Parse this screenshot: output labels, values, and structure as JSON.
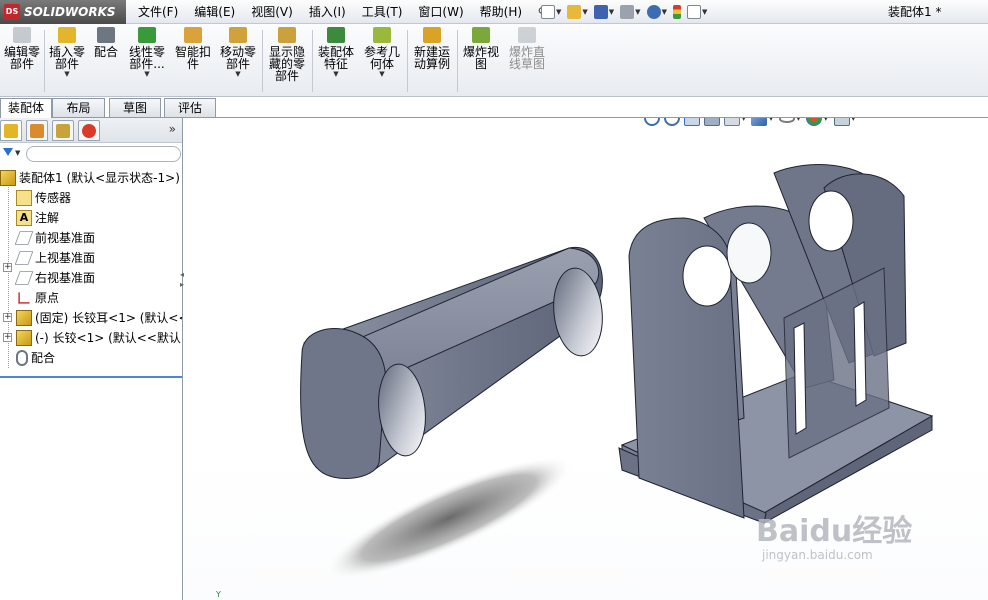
{
  "app": {
    "brand": "SOLIDWORKS",
    "brand_mark": "DS",
    "document_title": "装配体1 *"
  },
  "menu": [
    {
      "label": "文件(F)"
    },
    {
      "label": "编辑(E)"
    },
    {
      "label": "视图(V)"
    },
    {
      "label": "插入(I)"
    },
    {
      "label": "工具(T)"
    },
    {
      "label": "窗口(W)"
    },
    {
      "label": "帮助(H)"
    }
  ],
  "commands": [
    {
      "label": "编辑零\n部件",
      "icon": "edit-component-icon",
      "color": "#9aa3ad",
      "enabled": false,
      "dropdown": false
    },
    {
      "label": "插入零\n部件",
      "icon": "insert-component-icon",
      "color": "#e3b52a",
      "enabled": true,
      "dropdown": true
    },
    {
      "label": "配合",
      "icon": "mate-icon",
      "color": "#6d7681",
      "enabled": true,
      "dropdown": false
    },
    {
      "label": "线性零\n部件...",
      "icon": "linear-pattern-icon",
      "color": "#3a9a3a",
      "enabled": true,
      "dropdown": true
    },
    {
      "label": "智能扣\n件",
      "icon": "smart-fasteners-icon",
      "color": "#d9a23a",
      "enabled": true,
      "dropdown": false
    },
    {
      "label": "移动零\n部件",
      "icon": "move-component-icon",
      "color": "#cfa33a",
      "enabled": true,
      "dropdown": true
    },
    {
      "label": "显示隐\n藏的零\n部件",
      "icon": "show-hidden-icon",
      "color": "#caa13a",
      "enabled": true,
      "dropdown": false
    },
    {
      "label": "装配体\n特征",
      "icon": "assembly-features-icon",
      "color": "#3c8a3c",
      "enabled": true,
      "dropdown": true
    },
    {
      "label": "参考几\n何体",
      "icon": "reference-geometry-icon",
      "color": "#9ab83a",
      "enabled": true,
      "dropdown": true
    },
    {
      "label": "新建运\n动算例",
      "icon": "new-motion-study-icon",
      "color": "#d9a326",
      "enabled": true,
      "dropdown": false
    },
    {
      "label": "爆炸视\n图",
      "icon": "exploded-view-icon",
      "color": "#7aa83a",
      "enabled": true,
      "dropdown": false
    },
    {
      "label": "爆炸直\n线草图",
      "icon": "explode-line-sketch-icon",
      "color": "#a8b0b8",
      "enabled": false,
      "dropdown": false
    }
  ],
  "tabs": [
    {
      "label": "装配体",
      "active": true
    },
    {
      "label": "布局",
      "active": false
    },
    {
      "label": "草图",
      "active": false
    },
    {
      "label": "评估",
      "active": false
    }
  ],
  "panel_tabs": [
    {
      "icon": "featuremanager-icon",
      "color": "#e2b626"
    },
    {
      "icon": "propertymanager-icon",
      "color": "#d98b2e"
    },
    {
      "icon": "configurationmanager-icon",
      "color": "#c9a23a"
    },
    {
      "icon": "displaymanager-icon",
      "color": "#d93a2a"
    }
  ],
  "tree": [
    {
      "label": "装配体1  (默认<显示状态-1>)",
      "icon": "assembly-icon",
      "color": "#e0b626",
      "expander": "",
      "level": 0
    },
    {
      "label": "传感器",
      "icon": "sensors-icon",
      "color": "#e8c23a",
      "expander": "",
      "level": 1
    },
    {
      "label": "注解",
      "icon": "annotations-icon",
      "color": "#e8c23a",
      "expander": "+",
      "level": 1
    },
    {
      "label": "前视基准面",
      "icon": "plane-icon",
      "color": "#8a9098",
      "expander": "",
      "level": 1
    },
    {
      "label": "上视基准面",
      "icon": "plane-icon",
      "color": "#8a9098",
      "expander": "",
      "level": 1
    },
    {
      "label": "右视基准面",
      "icon": "plane-icon",
      "color": "#8a9098",
      "expander": "",
      "level": 1
    },
    {
      "label": "原点",
      "icon": "origin-icon",
      "color": "#c0282d",
      "expander": "",
      "level": 1
    },
    {
      "label": "(固定) 长铰耳<1>  (默认<<",
      "icon": "part-icon",
      "color": "#e0b626",
      "expander": "+",
      "level": 1
    },
    {
      "label": "(-) 长铰<1>  (默认<<默认>",
      "icon": "part-icon",
      "color": "#e0b626",
      "expander": "+",
      "level": 1
    },
    {
      "label": "配合",
      "icon": "mates-folder-icon",
      "color": "#6d7681",
      "expander": "",
      "level": 1
    }
  ],
  "viewport": {
    "background": "#ffffff",
    "part_color": "#7c8396",
    "triad_label": "Y",
    "headsup_tools": [
      {
        "icon": "zoom-to-fit-icon",
        "color": "#3c6db0",
        "dropdown": false
      },
      {
        "icon": "zoom-to-area-icon",
        "color": "#3c6db0",
        "dropdown": false
      },
      {
        "icon": "previous-view-icon",
        "color": "#3c6db0",
        "dropdown": false
      },
      {
        "icon": "section-view-icon",
        "color": "#7a8ea8",
        "dropdown": false
      },
      {
        "icon": "view-orientation-icon",
        "color": "#6b7c93",
        "dropdown": true
      },
      {
        "icon": "display-style-icon",
        "color": "#4a7bc0",
        "dropdown": true
      },
      {
        "icon": "hide-show-items-icon",
        "color": "#7a7a7a",
        "dropdown": true
      },
      {
        "icon": "edit-appearance-icon",
        "color": "#3a9a3a",
        "dropdown": true
      },
      {
        "icon": "apply-scene-icon",
        "color": "#7a8ea8",
        "dropdown": true
      }
    ]
  },
  "watermark": {
    "brand": "Baidu经验",
    "url": "jingyan.baidu.com"
  }
}
